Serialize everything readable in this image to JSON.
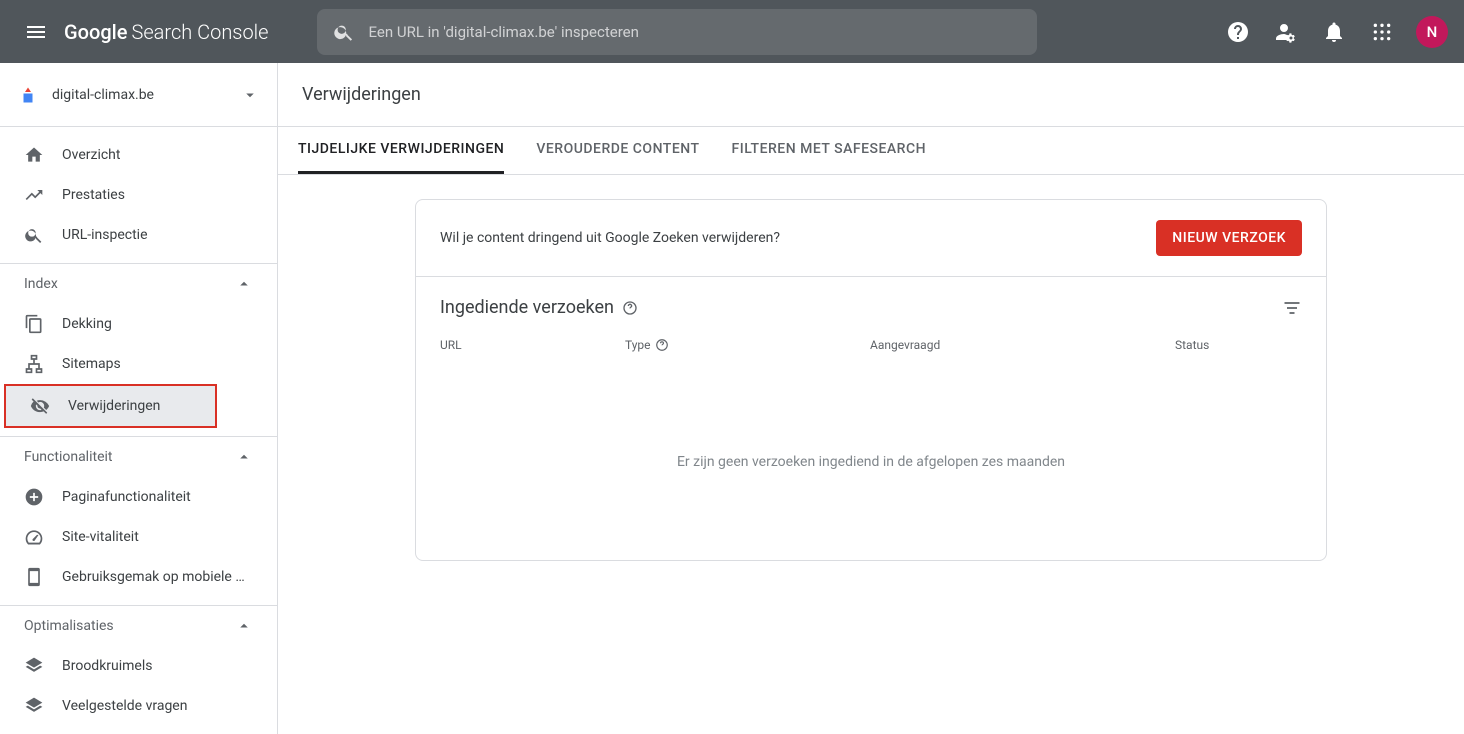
{
  "header": {
    "logo_google": "Google",
    "logo_sc": "Search Console",
    "search_placeholder": "Een URL in 'digital-climax.be' inspecteren",
    "avatar_initial": "N"
  },
  "sidebar": {
    "property_label": "digital-climax.be",
    "items_top": [
      {
        "key": "overview",
        "label": "Overzicht"
      },
      {
        "key": "performance",
        "label": "Prestaties"
      },
      {
        "key": "url-inspect",
        "label": "URL-inspectie"
      }
    ],
    "section_index": "Index",
    "items_index": [
      {
        "key": "coverage",
        "label": "Dekking"
      },
      {
        "key": "sitemaps",
        "label": "Sitemaps"
      },
      {
        "key": "removals",
        "label": "Verwijderingen"
      }
    ],
    "section_func": "Functionaliteit",
    "items_func": [
      {
        "key": "page-exp",
        "label": "Paginafunctionaliteit"
      },
      {
        "key": "vitals",
        "label": "Site-vitaliteit"
      },
      {
        "key": "mobile",
        "label": "Gebruiksgemak op mobiele …"
      }
    ],
    "section_opt": "Optimalisaties",
    "items_opt": [
      {
        "key": "breadcrumbs",
        "label": "Broodkruimels"
      },
      {
        "key": "faq",
        "label": "Veelgestelde vragen"
      }
    ]
  },
  "page": {
    "title": "Verwijderingen",
    "tabs": [
      {
        "key": "temp",
        "label": "Tijdelijke verwijderingen"
      },
      {
        "key": "outdated",
        "label": "Verouderde content"
      },
      {
        "key": "safesearch",
        "label": "Filteren met SafeSearch"
      }
    ],
    "prompt": "Wil je content dringend uit Google Zoeken verwijderen?",
    "new_request": "NIEUW VERZOEK",
    "sub_title": "Ingediende verzoeken",
    "columns": {
      "url": "URL",
      "type": "Type",
      "requested": "Aangevraagd",
      "status": "Status"
    },
    "empty": "Er zijn geen verzoeken ingediend in de afgelopen zes maanden"
  }
}
